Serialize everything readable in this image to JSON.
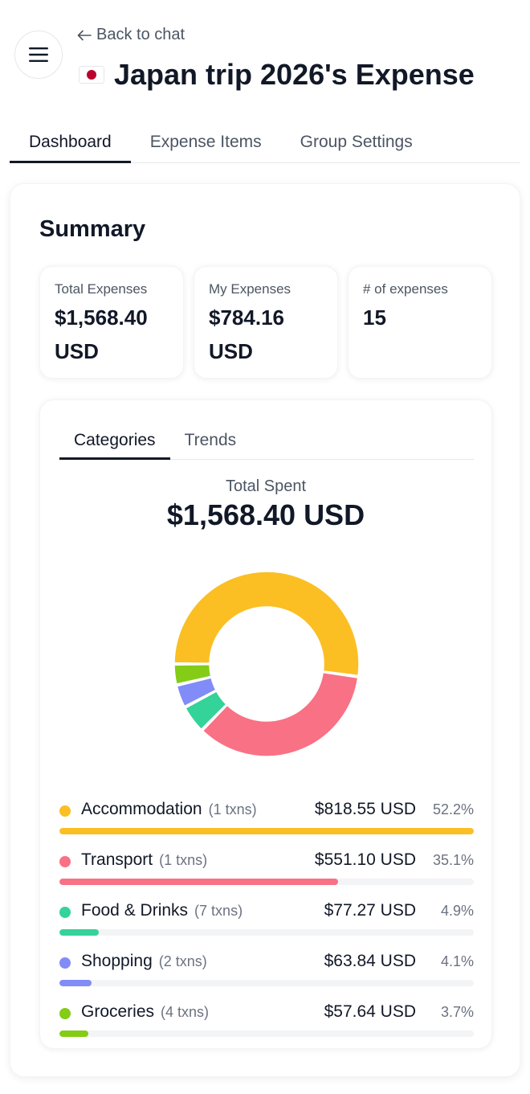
{
  "header": {
    "back_label": "Back to chat",
    "title": "Japan trip 2026's Expense",
    "flag_icon": "japan-flag-icon"
  },
  "tabs": [
    {
      "label": "Dashboard",
      "active": true
    },
    {
      "label": "Expense Items",
      "active": false
    },
    {
      "label": "Group Settings",
      "active": false
    }
  ],
  "summary": {
    "title": "Summary",
    "cards": [
      {
        "label": "Total Expenses",
        "value": "$1,568.40 USD"
      },
      {
        "label": "My Expenses",
        "value": "$784.16 USD"
      },
      {
        "label": "# of expenses",
        "value": "15"
      }
    ]
  },
  "chart_panel": {
    "tabs": [
      {
        "label": "Categories",
        "active": true
      },
      {
        "label": "Trends",
        "active": false
      }
    ],
    "total_label": "Total Spent",
    "total_value": "$1,568.40 USD"
  },
  "chart_data": {
    "type": "pie",
    "categories": [
      "Accommodation",
      "Transport",
      "Food & Drinks",
      "Shopping",
      "Groceries"
    ],
    "values": [
      818.55,
      551.1,
      77.27,
      63.84,
      57.64
    ],
    "percent": [
      52.2,
      35.1,
      4.9,
      4.1,
      3.7
    ],
    "colors": [
      "#fbbf24",
      "#f87185",
      "#34d399",
      "#818cf8",
      "#84cc16"
    ]
  },
  "categories": [
    {
      "name": "Accommodation",
      "txns": "(1 txns)",
      "amount": "$818.55 USD",
      "pct": "52.2%",
      "fraction": 1.0,
      "color": "#fbbf24"
    },
    {
      "name": "Transport",
      "txns": "(1 txns)",
      "amount": "$551.10 USD",
      "pct": "35.1%",
      "fraction": 0.673,
      "color": "#f87185"
    },
    {
      "name": "Food & Drinks",
      "txns": "(7 txns)",
      "amount": "$77.27 USD",
      "pct": "4.9%",
      "fraction": 0.094,
      "color": "#34d399"
    },
    {
      "name": "Shopping",
      "txns": "(2 txns)",
      "amount": "$63.84 USD",
      "pct": "4.1%",
      "fraction": 0.078,
      "color": "#818cf8"
    },
    {
      "name": "Groceries",
      "txns": "(4 txns)",
      "amount": "$57.64 USD",
      "pct": "3.7%",
      "fraction": 0.07,
      "color": "#84cc16"
    }
  ]
}
